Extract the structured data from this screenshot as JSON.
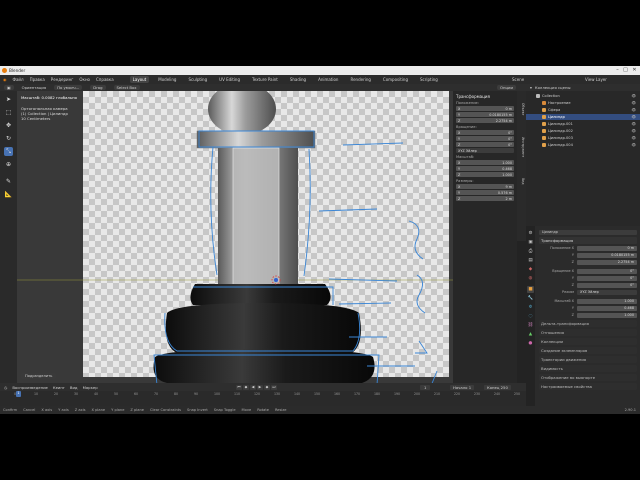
{
  "app": {
    "window_title": "Blender",
    "win_buttons": [
      "–",
      "□",
      "✕"
    ],
    "menu": [
      "Файл",
      "Правка",
      "Рендеринг",
      "Окно",
      "Справка"
    ],
    "workspaces": [
      "Layout",
      "Modeling",
      "Sculpting",
      "UV Editing",
      "Texture Paint",
      "Shading",
      "Animation",
      "Rendering",
      "Compositing",
      "Scripting"
    ],
    "active_workspace": "Layout",
    "scene_label": "Scene",
    "view_layer_label": "View Layer"
  },
  "viewport_header": {
    "orientation_label": "Ориентация",
    "pivot": "По умолч...",
    "snap": "Drag",
    "select": "Select Box",
    "options_label": "Опции"
  },
  "viewport": {
    "overlay_lines": [
      "Масштаб: 0.0082 глобально",
      "Ортогональная камера",
      "(1) Collection | Цилиндр",
      "10 Centimeters"
    ],
    "left_note": "Ортогональная сзади",
    "subdivide_button": "Подразделить"
  },
  "toolbar_icons": [
    "cursor-icon",
    "select-box-icon",
    "move-icon",
    "rotate-icon",
    "scale-icon",
    "transform-icon",
    "annotate-icon",
    "measure-icon"
  ],
  "npanel": {
    "tabs": [
      "Объект",
      "Инструмент",
      "Вид"
    ],
    "title": "Трансформация",
    "location_label": "Положение:",
    "location": [
      [
        "X",
        "0 m"
      ],
      [
        "Y",
        "0.0180155 m"
      ],
      [
        "Z",
        "2.2754 m"
      ]
    ],
    "rotation_label": "Вращение:",
    "rotation": [
      [
        "X",
        "0°"
      ],
      [
        "Y",
        "0°"
      ],
      [
        "Z",
        "0°"
      ]
    ],
    "rotation_mode": "XYZ Эйлер",
    "scale_label": "Масштаб:",
    "scale": [
      [
        "X",
        "1.000"
      ],
      [
        "Y",
        "0.468"
      ],
      [
        "Z",
        "1.000"
      ]
    ],
    "dimensions_label": "Размеры:",
    "dimensions": [
      [
        "X",
        "9 m"
      ],
      [
        "Y",
        "0.576 m"
      ],
      [
        "Z",
        "2 m"
      ]
    ]
  },
  "outliner": {
    "header": "Коллекция сцены",
    "items": [
      {
        "label": "Collection",
        "indent": 1,
        "color": "#bbbbbb",
        "selected": false
      },
      {
        "label": "Настроение",
        "indent": 2,
        "color": "#d88a3a",
        "selected": false
      },
      {
        "label": "Сфера",
        "indent": 2,
        "color": "#e0a04a",
        "selected": false
      },
      {
        "label": "Цилиндр",
        "indent": 2,
        "color": "#e0a04a",
        "selected": true
      },
      {
        "label": "Цилиндр.001",
        "indent": 2,
        "color": "#e0a04a",
        "selected": false
      },
      {
        "label": "Цилиндр.002",
        "indent": 2,
        "color": "#e0a04a",
        "selected": false
      },
      {
        "label": "Цилиндр.003",
        "indent": 2,
        "color": "#e0a04a",
        "selected": false
      },
      {
        "label": "Цилиндр.004",
        "indent": 2,
        "color": "#e0a04a",
        "selected": false
      }
    ]
  },
  "properties": {
    "object_name": "Цилиндр",
    "section_transform": "Трансформация",
    "location_label": "Положение X",
    "location": [
      "0 m",
      "0.0180155 m",
      "2.2754 m"
    ],
    "rotation_label": "Вращение X",
    "rotation": [
      "0°",
      "0°",
      "0°"
    ],
    "mode_label": "Режим",
    "mode": "XYZ Эйлер",
    "scale_label": "Масштаб X",
    "scale": [
      "1.000",
      "0.468",
      "1.000"
    ],
    "closed_sections": [
      "Дельта-трансформация",
      "Отношения",
      "Коллекции",
      "Создание экземпляров",
      "Траектории движения",
      "Видимость",
      "Отображение во вьюпорте",
      "Настраиваемые свойства"
    ]
  },
  "timeline": {
    "menu": [
      "Воспроизведение",
      "Кеинг",
      "Вид",
      "Маркер"
    ],
    "start_label": "Начало",
    "start": "1",
    "end_label": "Конец",
    "end": "250",
    "current_frame": "1",
    "ticks": [
      "0",
      "10",
      "20",
      "30",
      "40",
      "50",
      "60",
      "70",
      "80",
      "90",
      "100",
      "110",
      "120",
      "130",
      "140",
      "150",
      "160",
      "170",
      "180",
      "190",
      "200",
      "210",
      "220",
      "230",
      "240",
      "250"
    ]
  },
  "statusbar": {
    "items": [
      "Confirm",
      "Cancel",
      "X axis",
      "Y axis",
      "Z axis",
      "X plane",
      "Y plane",
      "Z plane",
      "Clear Constraints",
      "Snap Invert",
      "Snap Toggle",
      "Move",
      "Rotate",
      "Resize"
    ],
    "version": "2.90.1"
  }
}
